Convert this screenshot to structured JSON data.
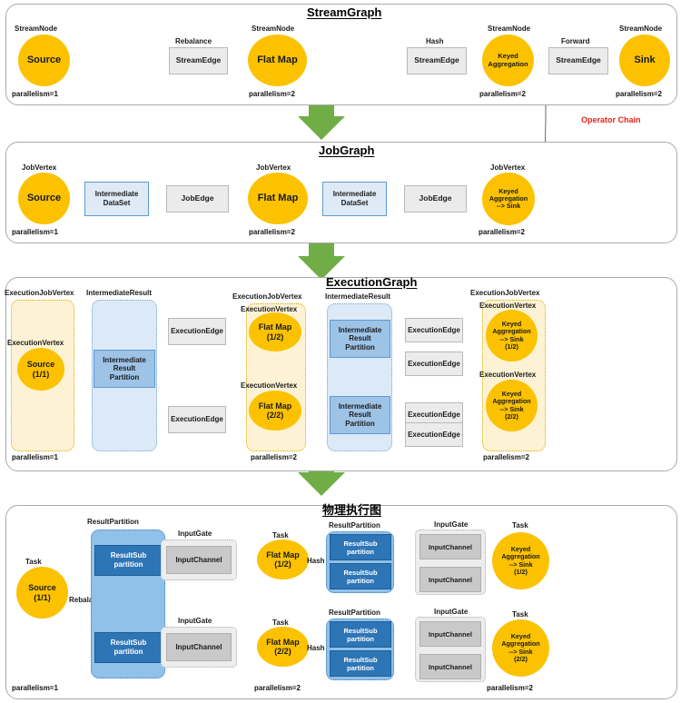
{
  "colors": {
    "node_yellow": "#FCC200",
    "arrow_green": "#70AD47",
    "blue_light": "#DEEBF7",
    "blue_mid": "#9DC3E6",
    "blue_dark": "#2E75B6",
    "grey_box": "#EBEBEB",
    "operator_chain_red": "#E8231A",
    "container_yellow": "#FDF3D4",
    "container_blue": "#DCE9F7",
    "container_blue_dark": "#8FC1E9"
  },
  "annotations": {
    "operator_chain": "Operator Chain"
  },
  "stream_graph": {
    "title": "StreamGraph",
    "captions": {
      "stream_node": "StreamNode",
      "rebalance": "Rebalance",
      "hash": "Hash",
      "forward": "Forward"
    },
    "nodes": [
      {
        "label": "Source",
        "parallelism": "parallelism=1"
      },
      {
        "label": "Flat Map",
        "parallelism": "parallelism=2"
      },
      {
        "label": "Keyed\nAggregation",
        "parallelism": "parallelism=2"
      },
      {
        "label": "Sink",
        "parallelism": "parallelism=2"
      }
    ],
    "edges": [
      {
        "label": "StreamEdge"
      },
      {
        "label": "StreamEdge"
      },
      {
        "label": "StreamEdge"
      }
    ]
  },
  "job_graph": {
    "title": "JobGraph",
    "captions": {
      "job_vertex": "JobVertex"
    },
    "nodes": [
      {
        "label": "Source",
        "parallelism": "parallelism=1"
      },
      {
        "label": "Flat Map",
        "parallelism": "parallelism=2"
      },
      {
        "label": "Keyed\nAggregation\n--> Sink",
        "parallelism": "parallelism=2"
      }
    ],
    "datasets": [
      {
        "label": "Intermediate\nDataSet"
      },
      {
        "label": "Intermediate\nDataSet"
      }
    ],
    "edges": [
      {
        "label": "JobEdge"
      },
      {
        "label": "JobEdge"
      }
    ]
  },
  "execution_graph": {
    "title": "ExecutionGraph",
    "captions": {
      "execution_job_vertex": "ExecutionJobVertex",
      "execution_vertex": "ExecutionVertex",
      "intermediate_result": "IntermediateResult"
    },
    "vertices": [
      {
        "label": "Source\n(1/1)",
        "parallelism": "parallelism=1"
      },
      {
        "label": "Flat Map\n(1/2)"
      },
      {
        "label": "Flat Map\n(2/2)",
        "parallelism": "parallelism=2"
      },
      {
        "label": "Keyed\nAggregation\n--> Sink\n(1/2)"
      },
      {
        "label": "Keyed\nAggregation\n--> Sink\n(2/2)",
        "parallelism": "parallelism=2"
      }
    ],
    "partitions": [
      {
        "label": "Intermediate\nResult\nPartition"
      },
      {
        "label": "Intermediate\nResult\nPartition"
      },
      {
        "label": "Intermediate\nResult\nPartition"
      }
    ],
    "edges": [
      {
        "label": "ExecutionEdge"
      },
      {
        "label": "ExecutionEdge"
      },
      {
        "label": "ExecutionEdge"
      },
      {
        "label": "ExecutionEdge"
      },
      {
        "label": "ExecutionEdge"
      },
      {
        "label": "ExecutionEdge"
      }
    ]
  },
  "physical_graph": {
    "title": "物理执行图",
    "captions": {
      "task": "Task",
      "result_partition": "ResultPartition",
      "input_gate": "InputGate",
      "rebalance": "Rebalance",
      "hash": "Hash"
    },
    "tasks": [
      {
        "label": "Source\n(1/1)",
        "parallelism": "parallelism=1"
      },
      {
        "label": "Flat Map\n(1/2)"
      },
      {
        "label": "Flat Map\n(2/2)",
        "parallelism": "parallelism=2"
      },
      {
        "label": "Keyed\nAggregation\n--> Sink\n(1/2)"
      },
      {
        "label": "Keyed\nAggregation\n--> Sink\n(2/2)",
        "parallelism": "parallelism=2"
      }
    ],
    "subpartitions": [
      {
        "label": "ResultSub\npartition"
      },
      {
        "label": "ResultSub\npartition"
      },
      {
        "label": "ResultSub\npartition"
      },
      {
        "label": "ResultSub\npartition"
      },
      {
        "label": "ResultSub\npartition"
      },
      {
        "label": "ResultSub\npartition"
      }
    ],
    "input_channels": [
      {
        "label": "InputChannel"
      },
      {
        "label": "InputChannel"
      },
      {
        "label": "InputChannel"
      },
      {
        "label": "InputChannel"
      },
      {
        "label": "InputChannel"
      },
      {
        "label": "InputChannel"
      }
    ]
  }
}
